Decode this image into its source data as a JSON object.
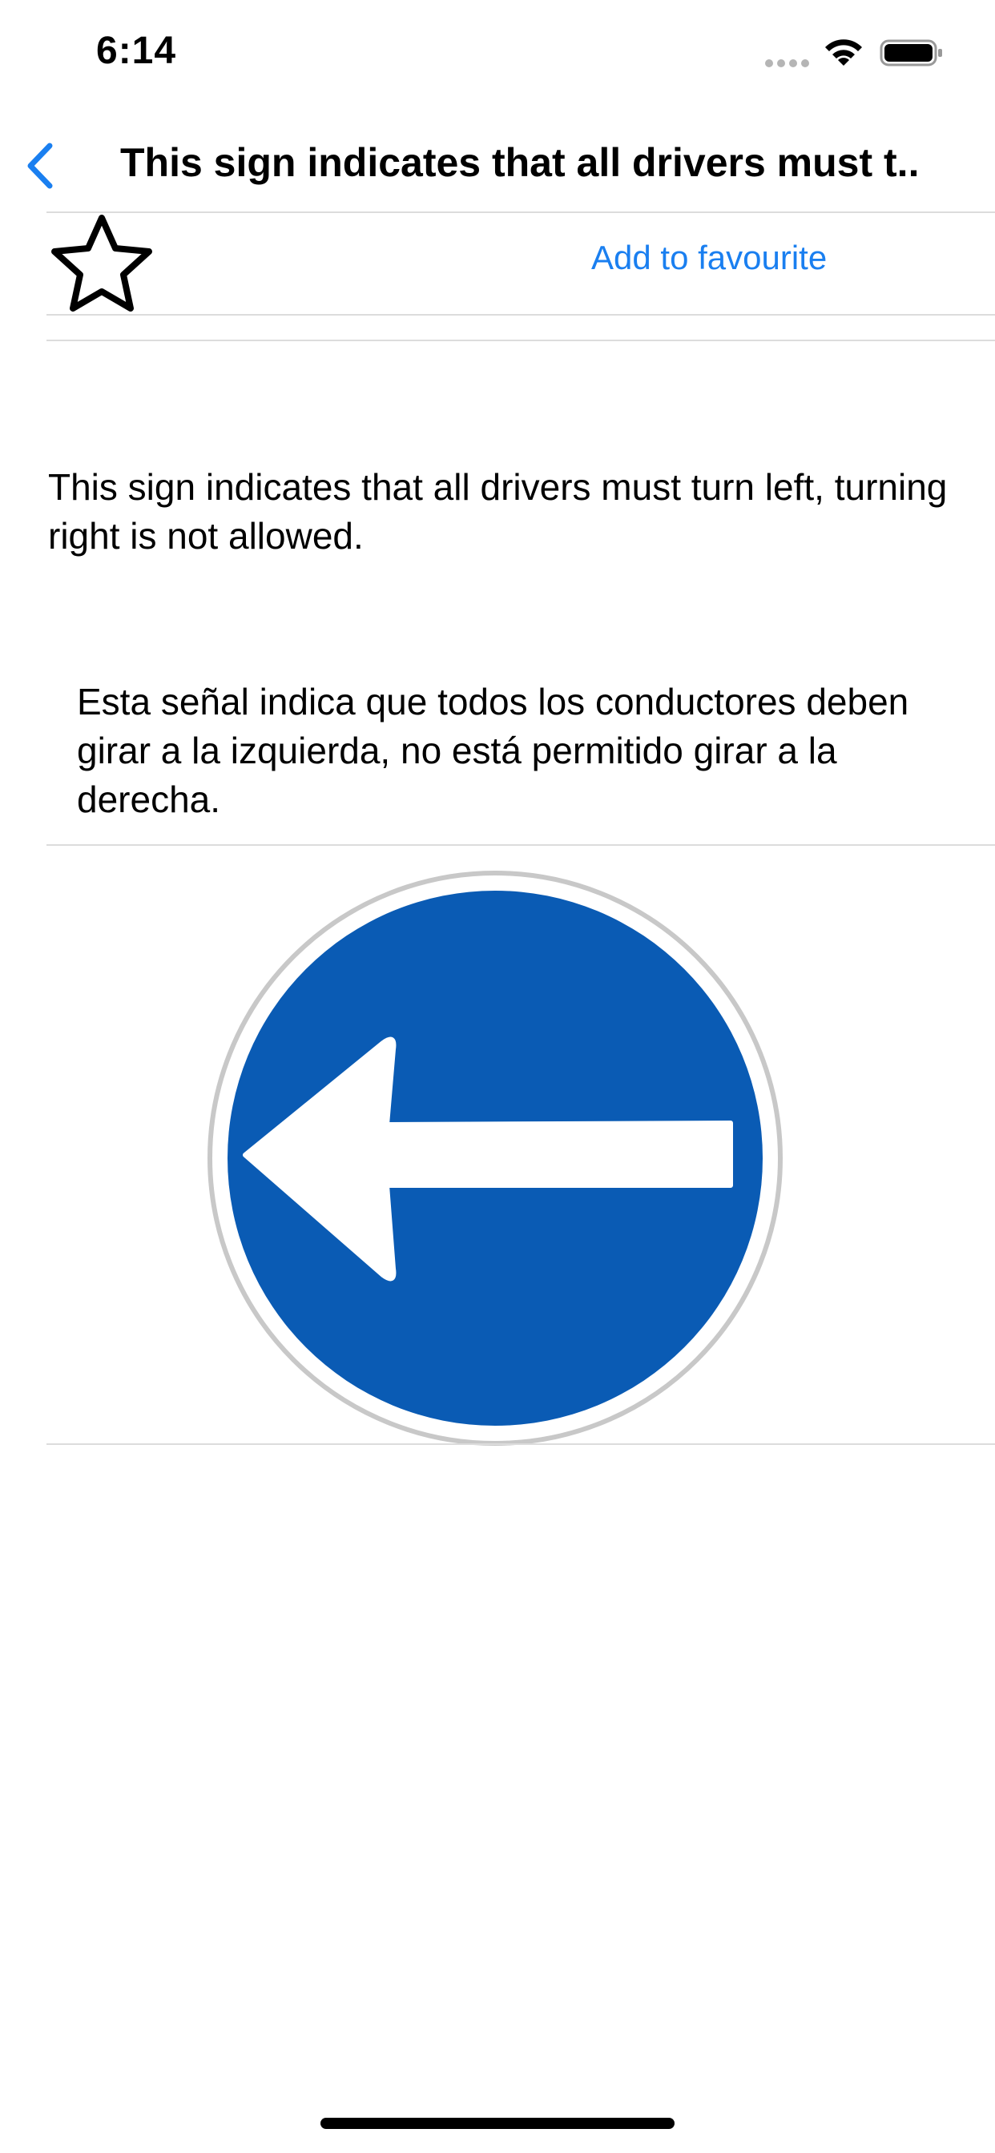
{
  "status_bar": {
    "time": "6:14"
  },
  "nav": {
    "title": "This sign indicates that all drivers must t...",
    "back_icon": "chevron-left-icon"
  },
  "favourite": {
    "star_icon": "star-outline-icon",
    "label": "Add to favourite"
  },
  "description": {
    "english": "This sign indicates that all drivers must turn left, turning right is not allowed.",
    "spanish": "Esta señal indica que todos los conductores deben girar a la izquierda, no está permitido girar a la derecha."
  },
  "sign": {
    "icon": "turn-left-sign-icon",
    "background_color": "#0a5bb4",
    "arrow_color": "#ffffff"
  },
  "colors": {
    "accent": "#1a7ff0",
    "divider": "#dcdcdc"
  }
}
